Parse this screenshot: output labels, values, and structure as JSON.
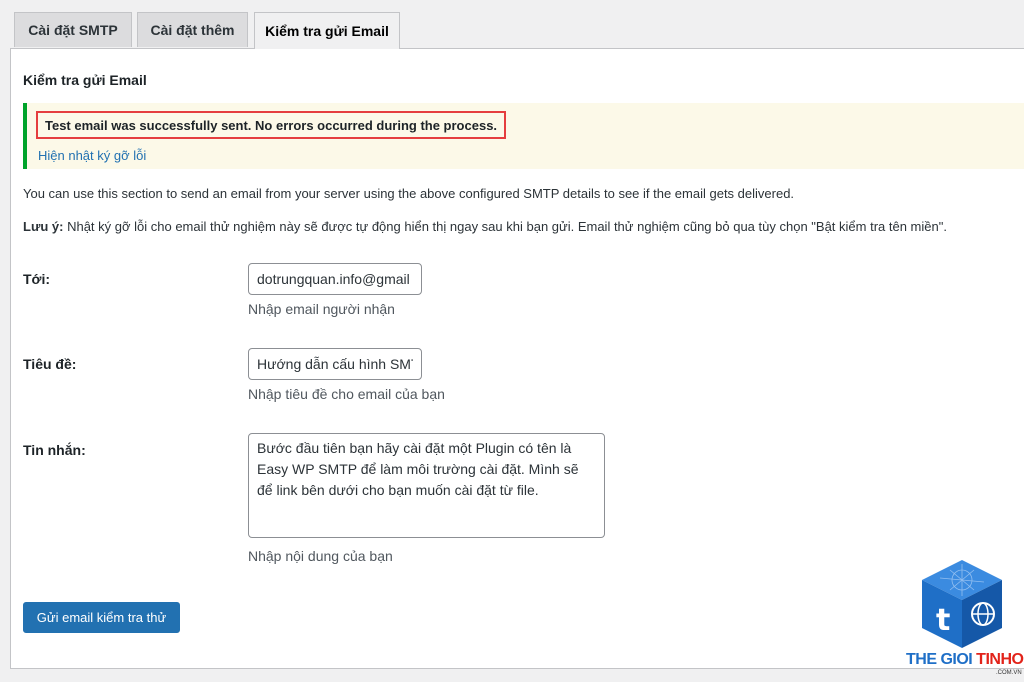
{
  "tabs": [
    {
      "label": "Cài đặt SMTP",
      "active": false
    },
    {
      "label": "Cài đặt thêm",
      "active": false
    },
    {
      "label": "Kiểm tra gửi Email",
      "active": true
    }
  ],
  "section": {
    "title": "Kiểm tra gửi Email"
  },
  "notice": {
    "message": "Test email was successfully sent. No errors occurred during the process.",
    "debug_link": "Hiện nhật ký gỡ lỗi"
  },
  "description": "You can use this section to send an email from your server using the above configured SMTP details to see if the email gets delivered.",
  "note": {
    "label": "Lưu ý:",
    "text": " Nhật ký gỡ lỗi cho email thử nghiệm này sẽ được tự động hiển thị ngay sau khi bạn gửi. Email thử nghiệm cũng bỏ qua tùy chọn \"Bật kiểm tra tên miền\"."
  },
  "form": {
    "to": {
      "label": "Tới:",
      "value": "dotrungquan.info@gmail",
      "help": "Nhập email người nhận"
    },
    "subject": {
      "label": "Tiêu đề:",
      "value": "Hướng dẫn cấu hình SMTP",
      "help": "Nhập tiêu đề cho email của bạn"
    },
    "message": {
      "label": "Tin nhắn:",
      "value": "Bước đầu tiên bạn hãy cài đặt một Plugin có tên là Easy WP SMTP để làm môi trường cài đặt. Mình sẽ để link bên dưới cho bạn muốn cài đặt từ file.",
      "help": "Nhập nội dung của bạn"
    },
    "submit_label": "Gửi email kiểm tra thử"
  },
  "logo": {
    "part1": "THE GIOI ",
    "part2": "TINHOC",
    "sub": ".COM.VN"
  },
  "colors": {
    "accent": "#2271b1",
    "success": "#00a32a",
    "highlight": "#e53e3e",
    "notice_bg": "#fcf9e8",
    "logo_blue": "#1f6fc7",
    "logo_red": "#e2231a"
  }
}
